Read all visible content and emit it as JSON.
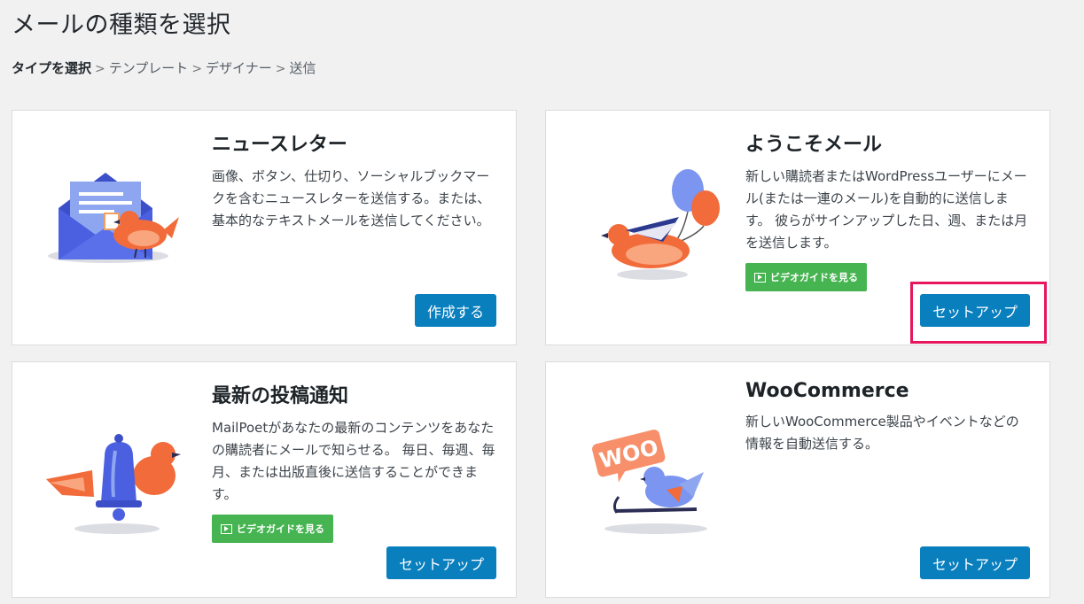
{
  "page": {
    "title": "メールの種類を選択"
  },
  "breadcrumb": {
    "steps": [
      "タイプを選択",
      "テンプレート",
      "デザイナー",
      "送信"
    ],
    "separator": ">"
  },
  "cards": [
    {
      "title": "ニュースレター",
      "description": "画像、ボタン、仕切り、ソーシャルブックマークを含むニュースレターを送信する。または、基本的なテキストメールを送信してください。",
      "button": "作成する",
      "illustration": "envelope-bird-icon"
    },
    {
      "title": "ようこそメール",
      "description": "新しい購読者またはWordPressユーザーにメール(または一連のメール)を自動的に送信します。 彼らがサインアップした日、週、または月を送信します。",
      "video_label": "ビデオガイドを見る",
      "button": "セットアップ",
      "illustration": "bird-balloons-icon"
    },
    {
      "title": "最新の投稿通知",
      "description": "MailPoetがあなたの最新のコンテンツをあなたの購読者にメールで知らせる。 毎日、毎週、毎月、または出版直後に送信することができます。",
      "video_label": "ビデオガイドを見る",
      "button": "セットアップ",
      "illustration": "bird-bell-icon"
    },
    {
      "title": "WooCommerce",
      "description": "新しいWooCommerce製品やイベントなどの情報を自動送信する。",
      "button": "セットアップ",
      "illustration": "woo-bird-icon",
      "badge": "WOO"
    }
  ],
  "colors": {
    "primary_button": "#0a7fbe",
    "video_button": "#46b450",
    "highlight": "#e6175c",
    "bird_orange": "#f26b3a",
    "bird_blue": "#5b7fe0"
  }
}
